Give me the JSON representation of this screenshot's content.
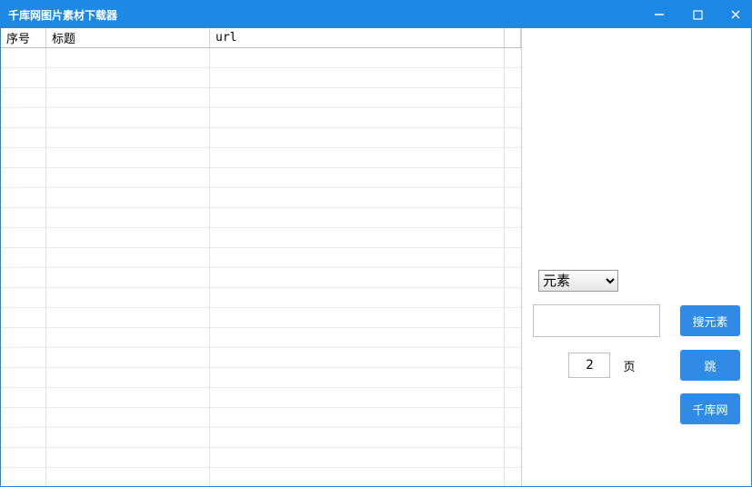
{
  "window": {
    "title": "千库网图片素材下载器"
  },
  "table": {
    "headers": {
      "index": "序号",
      "title": "标题",
      "url": "url"
    },
    "rows": [],
    "empty_row_count": 22
  },
  "sidebar": {
    "category_select": {
      "selected": "元素",
      "options": [
        "元素"
      ]
    },
    "search_value": "",
    "page_value": "2",
    "page_label": "页",
    "search_button": "搜元素",
    "jump_button": "跳",
    "site_button": "千库网"
  },
  "colors": {
    "accent": "#1E88E5",
    "button": "#2F8BE6"
  }
}
